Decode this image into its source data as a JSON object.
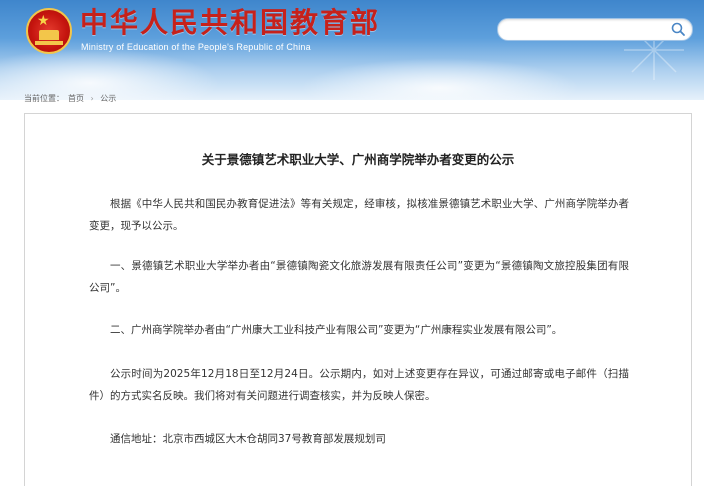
{
  "header": {
    "title_cn": "中华人民共和国教育部",
    "title_en": "Ministry of Education of the People's Republic of China",
    "search": {
      "placeholder": "",
      "value": ""
    }
  },
  "breadcrumb": {
    "prefix": "当前位置：",
    "home": "首页",
    "separator": "›",
    "current": "公示"
  },
  "article": {
    "title": "关于景德镇艺术职业大学、广州商学院举办者变更的公示",
    "paragraphs": [
      "根据《中华人民共和国民办教育促进法》等有关规定，经审核，拟核准景德镇艺术职业大学、广州商学院举办者变更，现予以公示。",
      "一、景德镇艺术职业大学举办者由“景德镇陶瓷文化旅游发展有限责任公司”变更为“景德镇陶文旅控股集团有限公司”。",
      "二、广州商学院举办者由“广州康大工业科技产业有限公司”变更为“广州康程实业发展有限公司”。",
      "公示时间为2025年12月18日至12月24日。公示期内，如对上述变更存在异议，可通过邮寄或电子邮件（扫描件）的方式实名反映。我们将对有关问题进行调查核实，并为反映人保密。",
      "通信地址：北京市西城区大木仓胡同37号教育部发展规划司"
    ]
  },
  "colors": {
    "brand_red": "#c6211b",
    "header_blue": "#3f86cc"
  }
}
